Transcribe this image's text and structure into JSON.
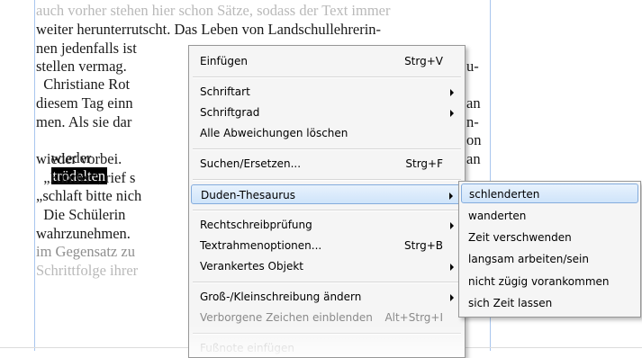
{
  "document": {
    "lines": [
      "auch vorher stehen hier schon Sätze, sodass der Text immer",
      "weiter herunterrutscht. Das Leben von Landschullehrerin-",
      "nen jedenfalls ist",
      "stellen vermag.",
      "  Christiane Rot",
      "diesem Tag einn",
      "men. Als sie dar",
      "wieder",
      "wieder vorbei.",
      "  „Kinder“, rief s",
      "„schlaft bitte nich",
      "  Die Schülerin",
      "wahrzunehmen.",
      "im Gegensatz zu",
      "Schrittfolge ihrer"
    ],
    "selected_word": "trödelten",
    "right_fragments": [
      "u-",
      "an",
      "n-",
      "on",
      "an"
    ]
  },
  "context_menu": {
    "items": [
      {
        "label": "Einfügen",
        "shortcut": "Strg+V"
      },
      {
        "label": "Schriftart"
      },
      {
        "label": "Schriftgrad"
      },
      {
        "label": "Alle Abweichungen löschen"
      },
      {
        "label": "Suchen/Ersetzen...",
        "shortcut": "Strg+F"
      },
      {
        "label": "Duden-Thesaurus"
      },
      {
        "label": "Rechtschreibprüfung"
      },
      {
        "label": "Textrahmenoptionen...",
        "shortcut": "Strg+B"
      },
      {
        "label": "Verankertes Objekt"
      },
      {
        "label": "Groß-/Kleinschreibung ändern"
      },
      {
        "label": "Verborgene Zeichen einblenden",
        "shortcut": "Alt+Strg+I"
      },
      {
        "label": "Fußnote einfügen"
      }
    ]
  },
  "thesaurus_submenu": {
    "items": [
      "schlenderten",
      "wanderten",
      "Zeit verschwenden",
      "langsam arbeiten/sein",
      "nicht zügig vorankommen",
      "sich Zeit lassen"
    ]
  },
  "colors": {
    "highlight": "#cfe4fa",
    "frame_border": "#a9c6ee",
    "selection": "#000000"
  }
}
